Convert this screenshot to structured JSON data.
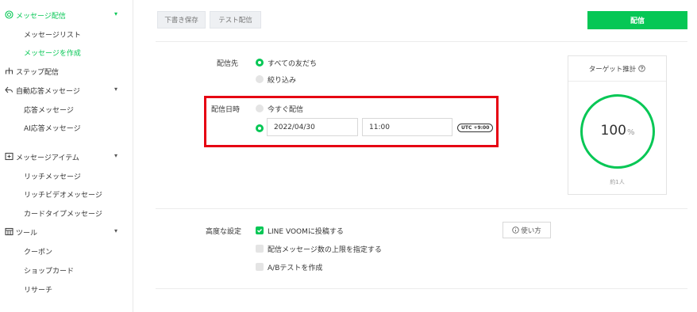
{
  "sidebar": {
    "groups": [
      {
        "label": "メッセージ配信",
        "icon": "broadcast-icon"
      },
      {
        "label": "ステップ配信",
        "icon": "step-icon"
      },
      {
        "label": "自動応答メッセージ",
        "icon": "reply-icon"
      },
      {
        "label": "メッセージアイテム",
        "icon": "message-item-icon"
      },
      {
        "label": "ツール",
        "icon": "tools-icon"
      }
    ],
    "items": [
      {
        "label": "メッセージリスト"
      },
      {
        "label": "メッセージを作成"
      },
      {
        "label": "応答メッセージ"
      },
      {
        "label": "AI応答メッセージ"
      },
      {
        "label": "リッチメッセージ"
      },
      {
        "label": "リッチビデオメッセージ"
      },
      {
        "label": "カードタイプメッセージ"
      },
      {
        "label": "クーポン"
      },
      {
        "label": "ショップカード"
      },
      {
        "label": "リサーチ"
      }
    ]
  },
  "toolbar": {
    "save_draft": "下書き保存",
    "test_send": "テスト配信",
    "send": "配信"
  },
  "recipients": {
    "label": "配信先",
    "options": [
      "すべての友だち",
      "絞り込み"
    ],
    "selected": "すべての友だち"
  },
  "schedule": {
    "label": "配信日時",
    "options": [
      "今すぐ配信"
    ],
    "selected": "scheduled",
    "date": "2022/04/30",
    "time": "11:00",
    "timezone": "UTC +9:00"
  },
  "advanced": {
    "label": "高度な設定",
    "options": [
      {
        "label": "LINE VOOMに投稿する",
        "checked": true
      },
      {
        "label": "配信メッセージ数の上限を指定する",
        "checked": false
      },
      {
        "label": "A/Bテストを作成",
        "checked": false
      }
    ],
    "help": "使い方"
  },
  "target": {
    "title": "ターゲット推計",
    "percent": "100",
    "percent_unit": "%",
    "count": "約1人"
  },
  "colors": {
    "accent": "#06c755",
    "highlight": "#e60012"
  }
}
